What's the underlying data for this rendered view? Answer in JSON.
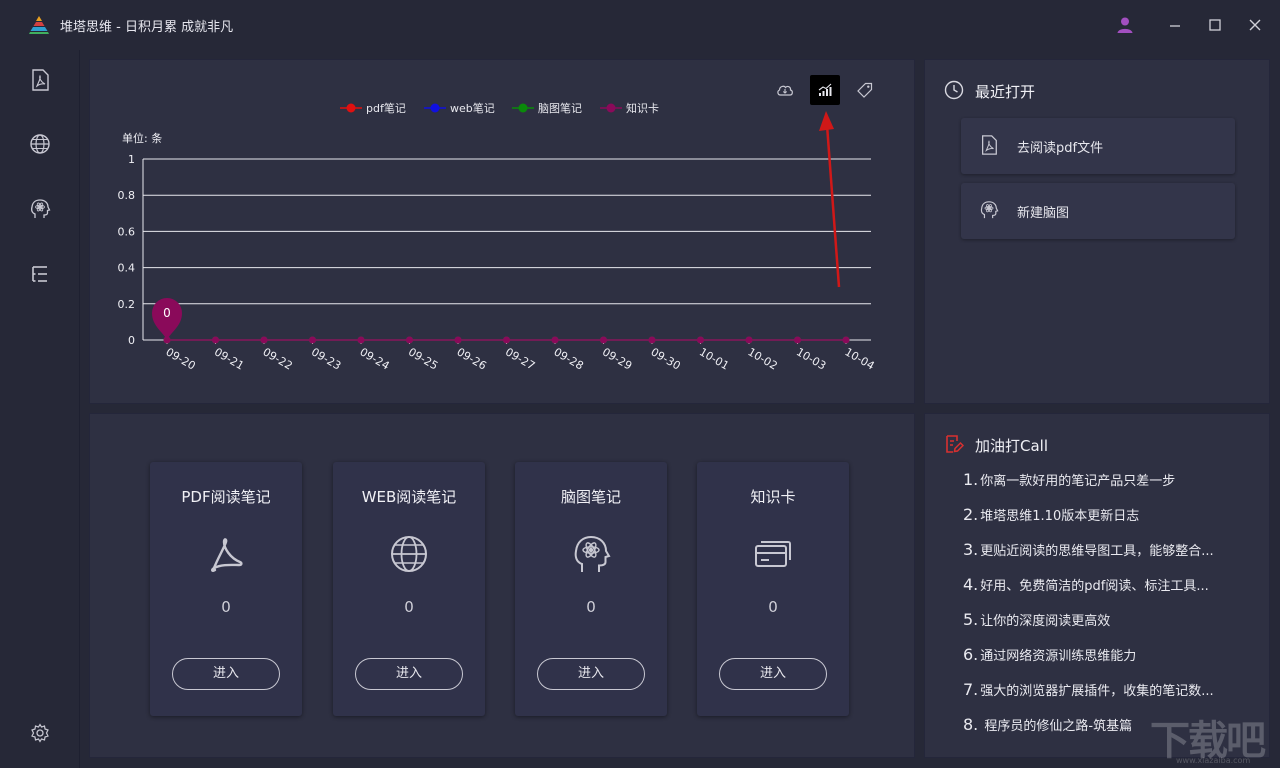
{
  "app": {
    "title": "堆塔思维 - 日积月累 成就非凡",
    "logo_icon": "pyramid-logo"
  },
  "window_controls": {
    "user_icon": "user-icon",
    "minimize_icon": "minimize-icon",
    "maximize_icon": "maximize-icon",
    "close_icon": "close-icon"
  },
  "sidebar": {
    "items": [
      {
        "icon": "pdf-icon"
      },
      {
        "icon": "globe-icon"
      },
      {
        "icon": "brain-icon"
      },
      {
        "icon": "list-icon"
      }
    ],
    "settings_icon": "gear-icon"
  },
  "chart_toolbar": {
    "tools": [
      "cloud-download-icon",
      "chart-icon",
      "tag-icon"
    ],
    "active": "chart-icon"
  },
  "chart_data": {
    "type": "line",
    "unit_label": "单位: 条",
    "legend": [
      "pdf笔记",
      "web笔记",
      "脑图笔记",
      "知识卡"
    ],
    "series": [
      {
        "name": "pdf笔记",
        "color": "#e01010",
        "values": [
          0,
          0,
          0,
          0,
          0,
          0,
          0,
          0,
          0,
          0,
          0,
          0,
          0,
          0,
          0
        ]
      },
      {
        "name": "web笔记",
        "color": "#1010e0",
        "values": [
          0,
          0,
          0,
          0,
          0,
          0,
          0,
          0,
          0,
          0,
          0,
          0,
          0,
          0,
          0
        ]
      },
      {
        "name": "脑图笔记",
        "color": "#0a8a0a",
        "values": [
          0,
          0,
          0,
          0,
          0,
          0,
          0,
          0,
          0,
          0,
          0,
          0,
          0,
          0,
          0
        ]
      },
      {
        "name": "知识卡",
        "color": "#8a0a5a",
        "values": [
          0,
          0,
          0,
          0,
          0,
          0,
          0,
          0,
          0,
          0,
          0,
          0,
          0,
          0,
          0
        ]
      }
    ],
    "categories": [
      "09-20",
      "09-21",
      "09-22",
      "09-23",
      "09-24",
      "09-25",
      "09-26",
      "09-27",
      "09-28",
      "09-29",
      "09-30",
      "10-01",
      "10-02",
      "10-03",
      "10-04"
    ],
    "y_ticks": [
      "0",
      "0.2",
      "0.4",
      "0.6",
      "0.8",
      "1"
    ],
    "ylim": [
      0,
      1
    ],
    "marker_label": "0",
    "grid": true
  },
  "recent": {
    "title": "最近打开",
    "title_icon": "clock-icon",
    "items": [
      {
        "label": "去阅读pdf文件",
        "icon": "pdf-icon"
      },
      {
        "label": "新建脑图",
        "icon": "brain-icon"
      }
    ]
  },
  "stats": {
    "cards": [
      {
        "title": "PDF阅读笔记",
        "count": "0",
        "button": "进入",
        "icon": "acrobat-icon"
      },
      {
        "title": "WEB阅读笔记",
        "count": "0",
        "button": "进入",
        "icon": "globe-icon"
      },
      {
        "title": "脑图笔记",
        "count": "0",
        "button": "进入",
        "icon": "brain-icon"
      },
      {
        "title": "知识卡",
        "count": "0",
        "button": "进入",
        "icon": "cards-icon"
      }
    ]
  },
  "call": {
    "title": "加油打Call",
    "title_icon": "edit-note-icon",
    "items": [
      {
        "num": "1.",
        "text": "你离一款好用的笔记产品只差一步"
      },
      {
        "num": "2.",
        "text": "堆塔思维1.10版本更新日志"
      },
      {
        "num": "3.",
        "text": "更贴近阅读的思维导图工具，能够整合..."
      },
      {
        "num": "4.",
        "text": "好用、免费简洁的pdf阅读、标注工具..."
      },
      {
        "num": "5.",
        "text": "让你的深度阅读更高效"
      },
      {
        "num": "6.",
        "text": "通过网络资源训练思维能力"
      },
      {
        "num": "7.",
        "text": "强大的浏览器扩展插件，收集的笔记数..."
      },
      {
        "num": "8.",
        "text": " 程序员的修仙之路-筑基篇"
      }
    ]
  },
  "watermark": {
    "text": "下载吧",
    "sub": "www.xiazaiba.com"
  }
}
